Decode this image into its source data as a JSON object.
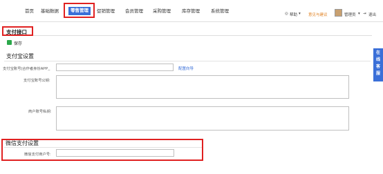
{
  "topnav": {
    "items": [
      "首页",
      "基础数据",
      "零售管理",
      "促销管理",
      "会员管理",
      "采购管理",
      "库存管理",
      "系统管理"
    ],
    "active_index": 2,
    "help": "帮助",
    "feedback": "意见与建议",
    "user": "管理员",
    "logout": "退出"
  },
  "page": {
    "section_title": "支付接口",
    "save_label": "保存"
  },
  "alipay": {
    "heading": "支付宝设置",
    "account_label": "支付宝账号(合作者身份APP_",
    "config_link": "配置向导",
    "pubkey_label": "支付宝账号公钥:",
    "privkey_label": "商户账号私钥:"
  },
  "wechat": {
    "heading": "微信支付设置",
    "merchant_label": "微信支付商户号:"
  },
  "side_tab": "在线客服"
}
